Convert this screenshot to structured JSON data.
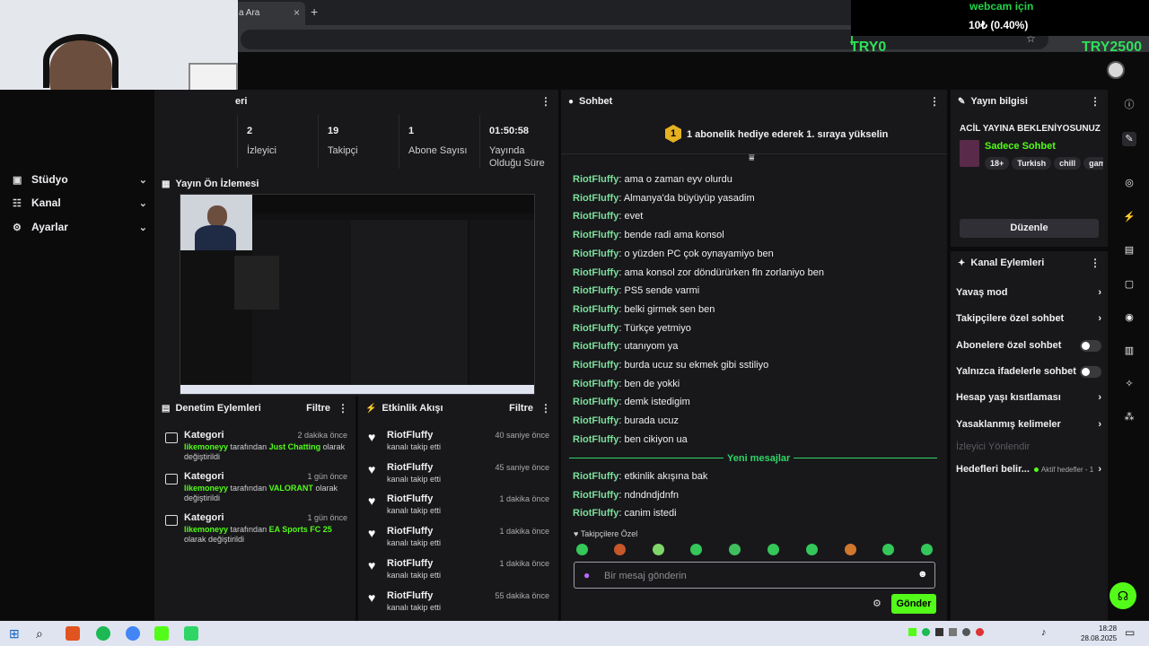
{
  "browser": {
    "tab_title": "a Ara"
  },
  "overlay": {
    "donation_title": "webcam için",
    "donation_amount": "10₺ (0.40%)",
    "goal_left": "TRY0",
    "goal_right": "TRY2500"
  },
  "sidebar": {
    "items": [
      {
        "label": "Stüdyo",
        "icon": "video-icon"
      },
      {
        "label": "Kanal",
        "icon": "users-icon"
      },
      {
        "label": "Ayarlar",
        "icon": "gear-icon"
      }
    ]
  },
  "stats": {
    "title_partial": "eri",
    "items": [
      {
        "value": "2",
        "label": "İzleyici"
      },
      {
        "value": "19",
        "label": "Takipçi"
      },
      {
        "value": "1",
        "label": "Abone Sayısı"
      },
      {
        "value": "01:50:58",
        "label": "Yayında Olduğu Süre"
      }
    ]
  },
  "preview": {
    "title": "Yayın Ön İzlemesi"
  },
  "chat": {
    "title": "Sohbet",
    "hype_badge": "1",
    "hype_text": "1 abonelik hediye ederek 1. sıraya yükselin",
    "messages_before": [
      {
        "user": "RiotFluffy",
        "text": "ama o zaman eyv olurdu"
      },
      {
        "user": "RiotFluffy",
        "text": "Almanya'da büyüyüp yasadim"
      },
      {
        "user": "RiotFluffy",
        "text": "evet"
      },
      {
        "user": "RiotFluffy",
        "text": "bende radi ama konsol"
      },
      {
        "user": "RiotFluffy",
        "text": "o yüzden PC çok oynayamiyo ben"
      },
      {
        "user": "RiotFluffy",
        "text": "ama konsol zor döndürürken fln zorlaniyo ben"
      },
      {
        "user": "RiotFluffy",
        "text": "PS5 sende varmi"
      },
      {
        "user": "RiotFluffy",
        "text": "belki girmek sen ben"
      },
      {
        "user": "RiotFluffy",
        "text": "Türkçe yetmiyo"
      },
      {
        "user": "RiotFluffy",
        "text": "utanıyom ya"
      },
      {
        "user": "RiotFluffy",
        "text": "burda ucuz su ekmek gibi sstiliyo"
      },
      {
        "user": "RiotFluffy",
        "text": "ben de yokki"
      },
      {
        "user": "RiotFluffy",
        "text": "demk istedigim"
      },
      {
        "user": "RiotFluffy",
        "text": "burada ucuz"
      },
      {
        "user": "RiotFluffy",
        "text": "ben cikiyon ua"
      }
    ],
    "new_messages_label": "Yeni mesajlar",
    "messages_after": [
      {
        "user": "RiotFluffy",
        "text": "etkinlik akışına bak"
      },
      {
        "user": "RiotFluffy",
        "text": "ndndndjdnfn"
      },
      {
        "user": "RiotFluffy",
        "text": "canim istedi"
      }
    ],
    "followers_only": "Takipçilere Özel",
    "input_placeholder": "Bir mesaj gönderin",
    "send_label": "Gönder"
  },
  "stream_info": {
    "title": "Yayın bilgisi",
    "stream_title": "ACİL YAYINA BEKLENİYOSUNUZ",
    "category": "Sadece Sohbet",
    "tags": [
      "18+",
      "Turkish",
      "chill",
      "gam"
    ],
    "edit_label": "Düzenle"
  },
  "channel_actions": {
    "title": "Kanal Eylemleri",
    "items": [
      {
        "label": "Yavaş mod",
        "kind": "chevron"
      },
      {
        "label": "Takipçilere özel sohbet",
        "kind": "chevron"
      },
      {
        "label": "Abonelere özel sohbet",
        "kind": "toggle"
      },
      {
        "label": "Yalnızca ifadelerle sohbet",
        "kind": "toggle"
      },
      {
        "label": "Hesap yaşı kısıtlaması",
        "kind": "chevron"
      },
      {
        "label": "Yasaklanmış kelimeler",
        "kind": "chevron"
      }
    ],
    "disabled_item": "İzleyici Yönlendir",
    "goals_label": "Hedefleri belir...",
    "goals_status": "Aktif hedefler - 1"
  },
  "mod_actions": {
    "title": "Denetim Eylemleri",
    "filter": "Filtre",
    "entries": [
      {
        "title": "Kategori",
        "time": "2 dakika önce",
        "user": "likemoneyy",
        "mid": "tarafından",
        "value": "Just Chatting",
        "end": "olarak değiştirildi"
      },
      {
        "title": "Kategori",
        "time": "1 gün önce",
        "user": "likemoneyy",
        "mid": "tarafından",
        "value": "VALORANT",
        "end": "olarak değiştirildi"
      },
      {
        "title": "Kategori",
        "time": "1 gün önce",
        "user": "likemoneyy",
        "mid": "tarafından",
        "value": "EA Sports FC 25",
        "end": "olarak değiştirildi"
      }
    ]
  },
  "activity": {
    "title": "Etkinlik Akışı",
    "filter": "Filtre",
    "entries": [
      {
        "user": "RiotFluffy",
        "action": "kanalı takip etti",
        "time": "40 saniye önce"
      },
      {
        "user": "RiotFluffy",
        "action": "kanalı takip etti",
        "time": "45 saniye önce"
      },
      {
        "user": "RiotFluffy",
        "action": "kanalı takip etti",
        "time": "1 dakika önce"
      },
      {
        "user": "RiotFluffy",
        "action": "kanalı takip etti",
        "time": "1 dakika önce"
      },
      {
        "user": "RiotFluffy",
        "action": "kanalı takip etti",
        "time": "1 dakika önce"
      },
      {
        "user": "RiotFluffy",
        "action": "kanalı takip etti",
        "time": "55 dakika önce"
      }
    ]
  },
  "taskbar": {
    "time": "18:28",
    "date": "28.08.2025"
  },
  "colors": {
    "accent": "#53fc18",
    "username": "#7ddf9c",
    "panel": "#18181b",
    "background": "#0b0b0c"
  }
}
